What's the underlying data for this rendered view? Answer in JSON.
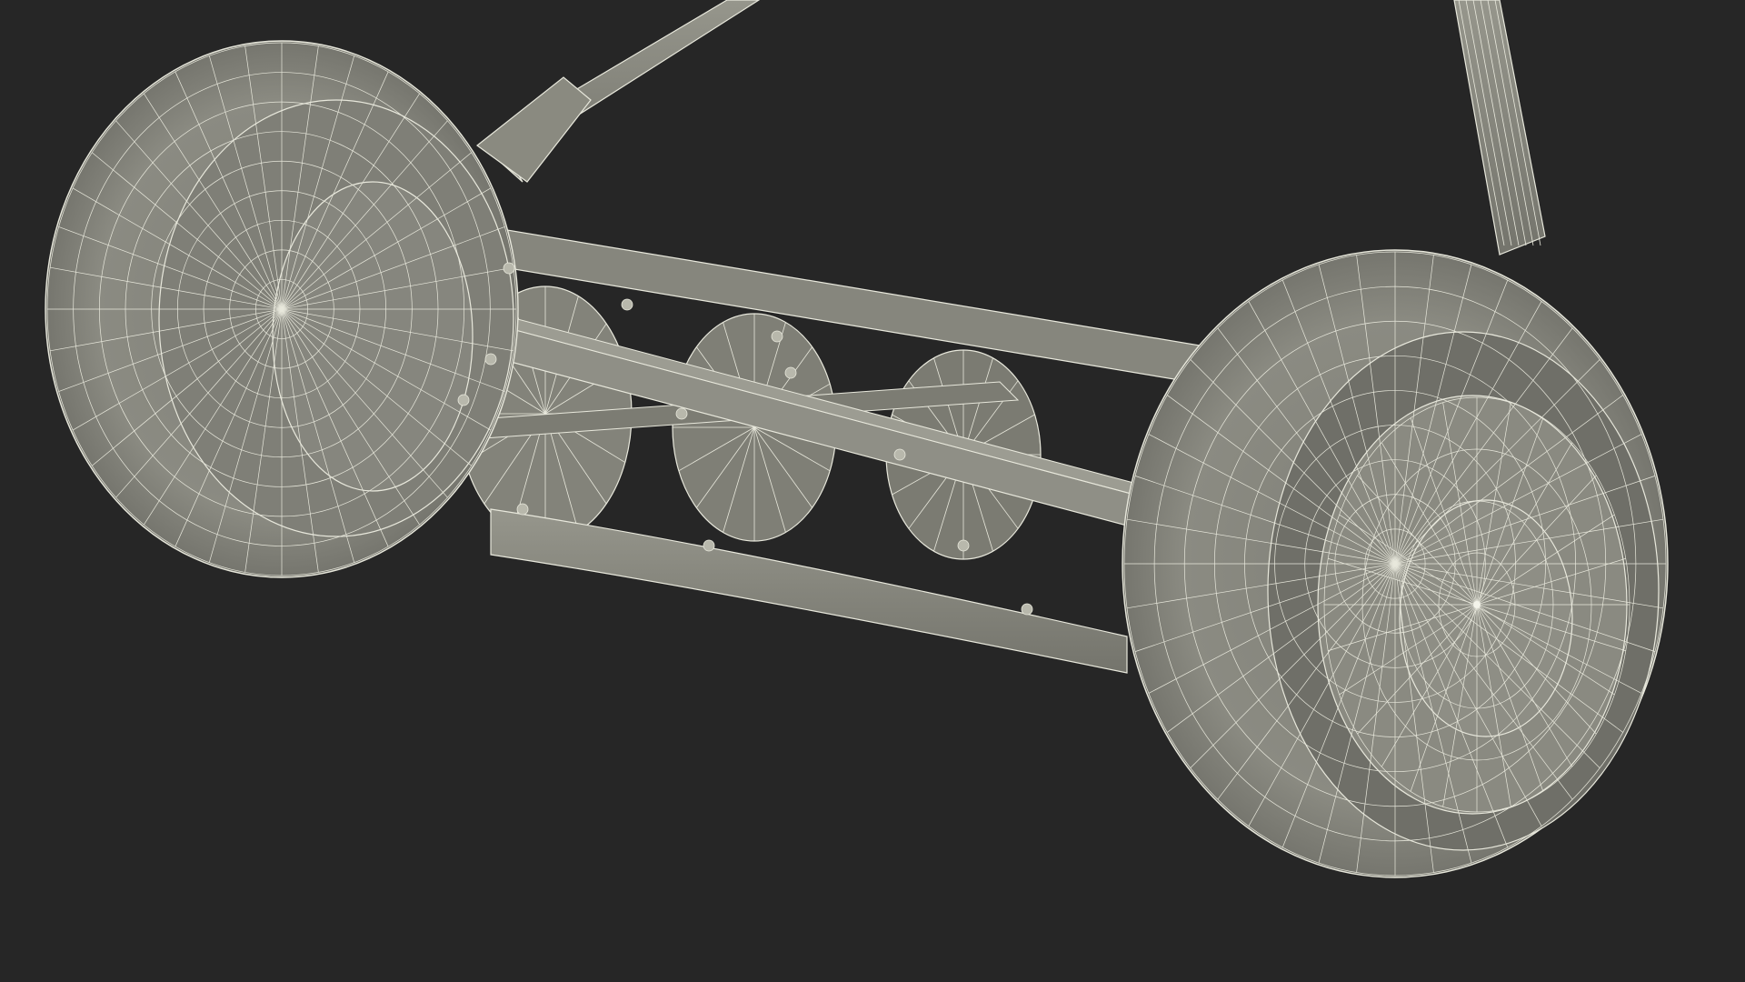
{
  "scene": {
    "subject": "reel-lawn-mower-wireframe",
    "colors": {
      "background": "#262626",
      "body": "#8a8a80",
      "body_dark": "#6f6f67",
      "body_light": "#9a9a90",
      "wire": "#e8e8dc",
      "shadow": "#55554e"
    },
    "icons": {
      "wheel_left": "left-wheel",
      "wheel_right": "right-wheel",
      "reel": "reel-blades",
      "handle": "handle-bars"
    }
  }
}
